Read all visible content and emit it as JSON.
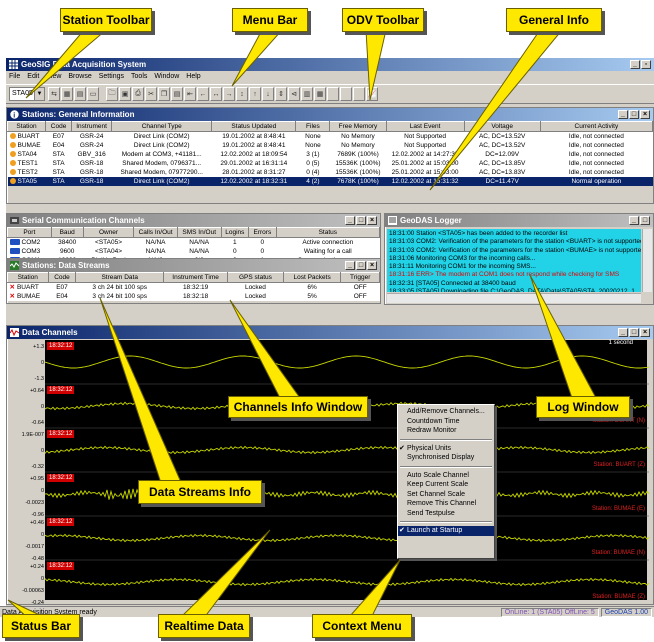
{
  "callouts": {
    "station_toolbar": "Station Toolbar",
    "menu_bar": "Menu Bar",
    "odv_toolbar": "ODV Toolbar",
    "general_info": "General Info",
    "channels_info": "Channels Info Window",
    "log_window": "Log Window",
    "data_streams_info": "Data Streams Info",
    "status_bar": "Status Bar",
    "realtime_data": "Realtime Data",
    "context_menu": "Context Menu"
  },
  "app": {
    "title": "GeoSIG Data Acquisition System",
    "menu": [
      "File",
      "Edit",
      "View",
      "Browse",
      "Settings",
      "Tools",
      "Window",
      "Help"
    ],
    "station_select": "STA05"
  },
  "general": {
    "title": "Stations: General Information",
    "columns": [
      "Station",
      "Code",
      "Instrument",
      "Channel Type",
      "Status Updated",
      "Files",
      "Free Memory",
      "Last Event",
      "Voltage",
      "Current Activity"
    ],
    "rows": [
      [
        "BUART",
        "E07",
        "GSR-24",
        "Direct Link (COM2)",
        "19.01.2002 at 8:48:41",
        "None",
        "No Memory",
        "Not Supported",
        "AC, DC=13.52V",
        "Idle, not connected"
      ],
      [
        "BUMAE",
        "E04",
        "GSR-24",
        "Direct Link (COM2)",
        "19.01.2002 at 8:48:41",
        "None",
        "No Memory",
        "Not Supported",
        "AC, DC=13.52V",
        "Idle, not connected"
      ],
      [
        "STA04",
        "STA",
        "GBV_316",
        "Modem at COM3, +41181...",
        "12.02.2002 at 18:09:54",
        "3 (1)",
        "7689K (100%)",
        "12.02.2002 at 14:27:35",
        "DC=12.09V",
        "Idle, not connected"
      ],
      [
        "TEST1",
        "STA",
        "GSR-18",
        "Shared Modem, 0796371...",
        "29.01.2002 at 16:31:14",
        "0 (5)",
        "15536K (100%)",
        "25.01.2002 at 15:03:00",
        "AC, DC=13.85V",
        "Idle, not connected"
      ],
      [
        "TEST2",
        "STA",
        "GSR-18",
        "Shared Modem, 07977290...",
        "28.01.2002 at 8:31:27",
        "0 (4)",
        "15536K (100%)",
        "25.01.2002 at 15:03:00",
        "AC, DC=13.83V",
        "Idle, not connected"
      ],
      [
        "STA05",
        "STA",
        "GSR-18",
        "Direct Link (COM2)",
        "12.02.2002 at 18:32:31",
        "4 (2)",
        "7678K (100%)",
        "12.02.2002 at 15:31:32",
        "DC=11.47V",
        "Normal operation"
      ]
    ]
  },
  "serial": {
    "title": "Serial Communication Channels",
    "columns": [
      "Port",
      "Baud",
      "Owner",
      "Calls In/Out",
      "SMS In/Out",
      "Logins",
      "Errors",
      "Status"
    ],
    "rows": [
      [
        "COM2",
        "38400",
        "<STA05>",
        "NA/NA",
        "NA/NA",
        "1",
        "0",
        "Active connection"
      ],
      [
        "COM3",
        "9600",
        "<STA04>",
        "NA/NA",
        "NA/NA",
        "0",
        "0",
        "Waiting for a call"
      ],
      [
        "COM1",
        "19200",
        "DialUp Pool",
        "NA/0",
        "0/0",
        "0",
        "1",
        "Communication error"
      ]
    ]
  },
  "streams": {
    "title": "Stations: Data Streams",
    "columns": [
      "Station",
      "Code",
      "Stream Data",
      "Instrument Time",
      "GPS status",
      "Lost Packets",
      "Trigger"
    ],
    "rows": [
      [
        "BUART",
        "E07",
        "3 ch 24 bit 100 sps",
        "18:32:19",
        "Locked",
        "6%",
        "OFF"
      ],
      [
        "BUMAE",
        "E04",
        "3 ch 24 bit 100 sps",
        "18:32:18",
        "Locked",
        "5%",
        "OFF"
      ]
    ]
  },
  "logger": {
    "title": "GeoDAS Logger",
    "lines": [
      {
        "text": "18:31:00 Station <STA05> has been added to the recorder list",
        "kind": "normal"
      },
      {
        "text": "18:31:03 COM2: Verification of the parameters for the station <BUART> is not supported",
        "kind": "normal"
      },
      {
        "text": "18:31:03 COM2: Verification of the parameters for the station <BUMAE> is not supported",
        "kind": "normal"
      },
      {
        "text": "18:31:06 Monitoring COM3 for the incoming calls...",
        "kind": "normal"
      },
      {
        "text": "18:31:11 Monitoring COM1 for the incoming SMS...",
        "kind": "normal"
      },
      {
        "text": "18:31:16 ERR> The modem at COM1 does not respond while checking for SMS",
        "kind": "err"
      },
      {
        "text": "18:32:31 [STA05] Connected at 38400 baud",
        "kind": "normal"
      },
      {
        "text": "18:33:05 [STA05] Downloading file C:\\GeoDAS_DATA\\Data\\STA05\\STA_20020212_1",
        "kind": "normal"
      },
      {
        "text": "18:33:12 [STA05] File C:\\GeoDAS_DATA\\Data\\STA05\\STA_20020212_142735.GSR",
        "kind": "normal"
      },
      {
        "text": "18:33:26 [STA05] WRN> Overwriting file C:\\GeoDAS_DATA\\Data\\STA05\\STA_2002",
        "kind": "warn"
      },
      {
        "text": "18:33:35 [STA05] File C:\\GeoDAS_DATA\\Data\\STA05\\STA_20020212_142735.GSR",
        "kind": "normal"
      }
    ]
  },
  "channels": {
    "title": "Data Channels",
    "scale_label": "1 second",
    "rows": [
      {
        "time": "18:32:12",
        "y": [
          "+1.3",
          "0",
          "-1.3"
        ],
        "station": ""
      },
      {
        "time": "18:32:12",
        "y": [
          "+0.64",
          "0",
          "-0.64"
        ],
        "station": "Station: BUART (N)"
      },
      {
        "time": "18:32:12",
        "y": [
          "1.9E-007",
          "0",
          "-0.32"
        ],
        "station": "Station: BUART (Z)"
      },
      {
        "time": "18:32:12",
        "y": [
          "+0.95",
          "0",
          "-0.0023",
          "-0.96"
        ],
        "station": "Station: BUMAE (E)"
      },
      {
        "time": "18:32:12",
        "y": [
          "+0.46",
          "0",
          "-0.0017",
          "-0.48"
        ],
        "station": "Station: BUMAE (N)"
      },
      {
        "time": "18:32:12",
        "y": [
          "+0.24",
          "0",
          "-0.00063",
          "-0.24"
        ],
        "station": "Station: BUMAE (Z)"
      }
    ]
  },
  "context_menu": {
    "items": [
      {
        "label": "Add/Remove Channels...",
        "checked": false
      },
      {
        "label": "Countdown Time",
        "checked": false
      },
      {
        "label": "Redraw Monitor",
        "checked": false
      },
      {
        "sep": true
      },
      {
        "label": "Physical Units",
        "checked": true
      },
      {
        "label": "Synchronised Display",
        "checked": false
      },
      {
        "sep": true
      },
      {
        "label": "Auto Scale Channel",
        "checked": false
      },
      {
        "label": "Keep Current Scale",
        "checked": false
      },
      {
        "label": "Set Channel Scale",
        "checked": false
      },
      {
        "label": "Remove This Channel",
        "checked": false
      },
      {
        "label": "Send Testpulse",
        "checked": false
      },
      {
        "sep": true
      },
      {
        "label": "Launch at Startup",
        "checked": true,
        "highlight": true
      }
    ]
  },
  "status": {
    "text": "Data Acquisition System ready",
    "online": "OnLine: 1 (STA05)  OffLine: 5",
    "version": "GeoDAS 1.00"
  },
  "colors": {
    "title_active": "#0a246a",
    "log_bg": "#22d3e8",
    "trace": "#c8d800",
    "callout": "#ffe800",
    "station_text": "#e02020"
  }
}
